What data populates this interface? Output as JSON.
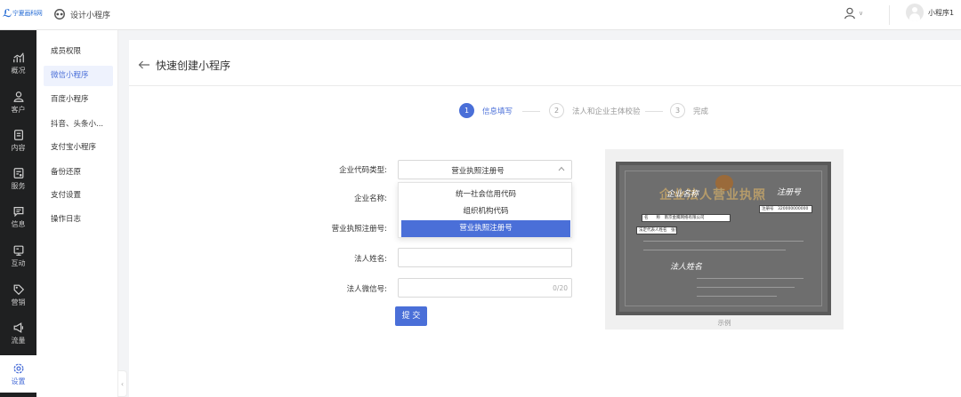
{
  "topbar": {
    "logo_text": "宁夏画科网",
    "app_title": "设计小程序",
    "user_name": "小程序1"
  },
  "leftnav": [
    {
      "label": "概况",
      "icon": "chart-icon"
    },
    {
      "label": "客户",
      "icon": "user-icon"
    },
    {
      "label": "内容",
      "icon": "document-icon"
    },
    {
      "label": "服务",
      "icon": "service-icon"
    },
    {
      "label": "信息",
      "icon": "message-icon"
    },
    {
      "label": "互动",
      "icon": "interact-icon"
    },
    {
      "label": "营销",
      "icon": "tag-icon"
    },
    {
      "label": "流量",
      "icon": "megaphone-icon"
    },
    {
      "label": "设置",
      "icon": "settings-icon",
      "active": true
    }
  ],
  "subnav": [
    {
      "label": "成员权限"
    },
    {
      "label": "微信小程序",
      "active": true
    },
    {
      "label": "百度小程序"
    },
    {
      "label": "抖音、头条小..."
    },
    {
      "label": "支付宝小程序"
    },
    {
      "label": "备份还原"
    },
    {
      "label": "支付设置"
    },
    {
      "label": "操作日志"
    }
  ],
  "page": {
    "title": "快速创建小程序"
  },
  "steps": [
    {
      "num": "1",
      "label": "信息填写",
      "active": true
    },
    {
      "num": "2",
      "label": "法人和企业主体校验",
      "active": false
    },
    {
      "num": "3",
      "label": "完成",
      "active": false
    }
  ],
  "form": {
    "code_type_label": "企业代码类型:",
    "code_type_value": "营业执照注册号",
    "code_type_options": [
      "统一社会信用代码",
      "组织机构代码",
      "营业执照注册号"
    ],
    "company_name_label": "企业名称:",
    "license_no_label": "营业执照注册号:",
    "legal_name_label": "法人姓名:",
    "legal_wechat_label": "法人微信号:",
    "legal_wechat_counter": "0/20",
    "submit_label": "提 交"
  },
  "example": {
    "heading": "企业法人营业执照",
    "note_company": "企业名称",
    "note_reg": "注册号",
    "note_legal": "法人姓名",
    "box_company": "名　　称　南京金鹰网络有限公司",
    "box_reg": "注册号　320000000000",
    "box_legal": "法定代表人姓名　张某",
    "caption": "示例"
  },
  "colors": {
    "accent": "#4a6fd8",
    "nav_bg": "#1f2021",
    "page_bg": "#f3f4f6"
  }
}
